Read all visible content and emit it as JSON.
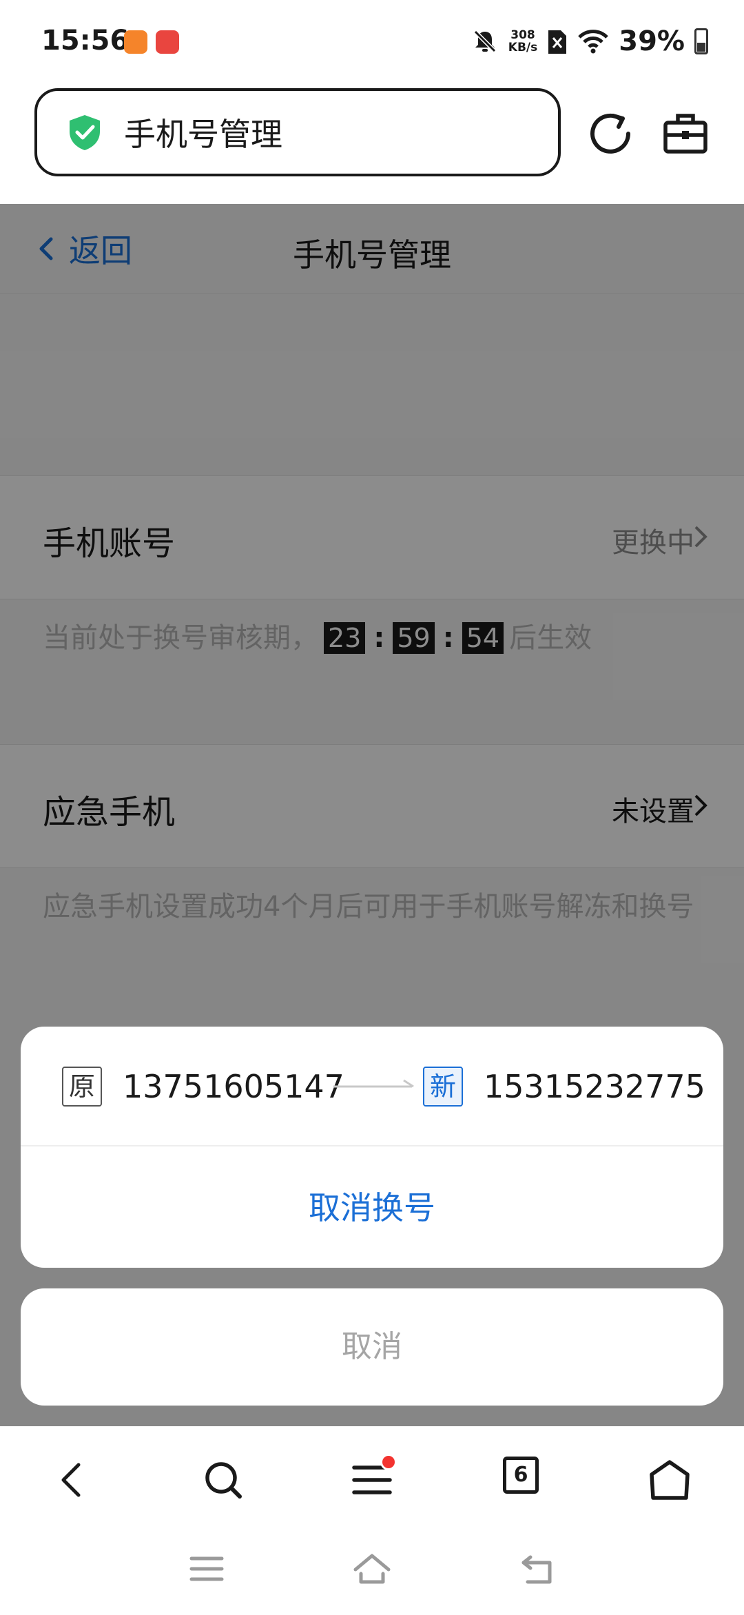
{
  "status_bar": {
    "time": "15:56",
    "network_speed_value": "308",
    "network_speed_unit": "KB/s",
    "battery_percent": "39%",
    "battery_level": 0.39,
    "icons": [
      "taobao-app-icon",
      "huawei-store-icon",
      "bell-muted-icon",
      "sim-off-icon",
      "wifi-icon",
      "battery-icon"
    ]
  },
  "browser": {
    "address_title": "手机号管理",
    "icons": [
      "secure-shield-icon",
      "refresh-icon",
      "toolbox-icon"
    ]
  },
  "page": {
    "back_label": "返回",
    "title": "手机号管理",
    "phone_account": {
      "label": "手机账号",
      "status": "更换中"
    },
    "review_hint": {
      "prefix": "当前处于换号审核期，",
      "hours": "23",
      "minutes": "59",
      "seconds": "54",
      "suffix": "后生效"
    },
    "emergency_phone": {
      "label": "应急手机",
      "status": "未设置"
    },
    "emergency_hint": "应急手机设置成功4个月后可用于手机账号解冻和换号"
  },
  "action_sheet": {
    "old_tag": "原",
    "old_number": "13751605147",
    "new_tag": "新",
    "new_number": "15315232775",
    "cancel_change_label": "取消换号",
    "cancel_label": "取消"
  },
  "bottom_toolbar": {
    "tab_count": "6",
    "icons": [
      "back-icon",
      "search-icon",
      "menu-icon",
      "tabs-icon",
      "home-icon"
    ]
  },
  "system_nav": {
    "icons": [
      "recent-apps-icon",
      "home-icon",
      "back-icon"
    ]
  },
  "colors": {
    "accent_blue": "#1b6fd6",
    "shield_green": "#2fbf71",
    "notification_red": "#f3332f"
  }
}
